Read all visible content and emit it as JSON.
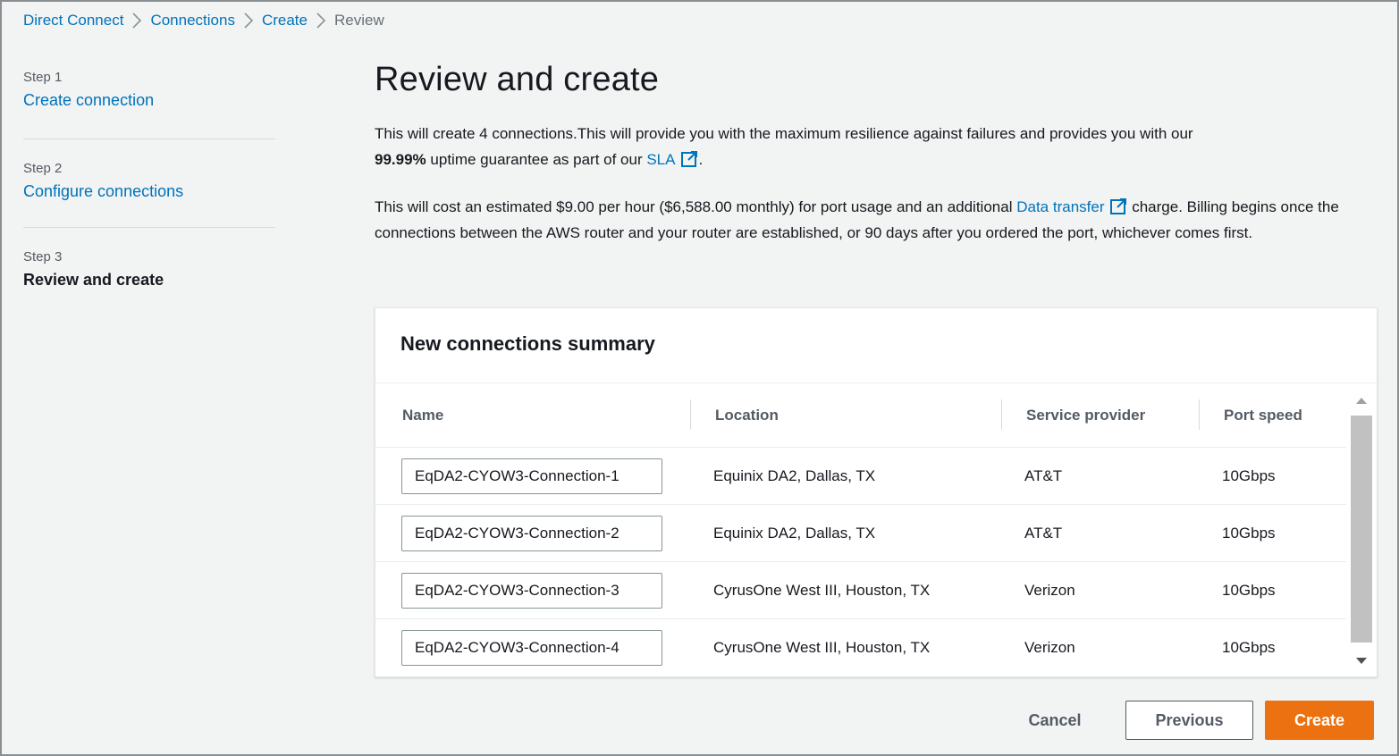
{
  "breadcrumb": [
    {
      "label": "Direct Connect"
    },
    {
      "label": "Connections"
    },
    {
      "label": "Create"
    },
    {
      "label": "Review"
    }
  ],
  "steps": [
    {
      "num": "Step 1",
      "label": "Create connection"
    },
    {
      "num": "Step 2",
      "label": "Configure connections"
    },
    {
      "num": "Step 3",
      "label": "Review and create"
    }
  ],
  "page": {
    "title": "Review and create",
    "intro_1": "This will create 4 connections.This will provide you with the maximum resilience against failures and provides you with our",
    "uptime": "99.99%",
    "intro_2": "uptime guarantee as part of our",
    "sla_link": "SLA",
    "cost_1": "This will cost an estimated $9.00 per hour ($6,588.00 monthly) for port usage and an additional",
    "data_transfer_link": "Data transfer",
    "cost_2": "charge.",
    "billing": "Billing begins once the connections between the AWS router and your router are established, or 90 days after you ordered the port, whichever comes first."
  },
  "summary": {
    "title": "New connections summary",
    "columns": [
      "Name",
      "Location",
      "Service provider",
      "Port speed"
    ],
    "rows": [
      {
        "name": "EqDA2-CYOW3-Connection-1",
        "location": "Equinix DA2, Dallas, TX",
        "provider": "AT&T",
        "speed": "10Gbps"
      },
      {
        "name": "EqDA2-CYOW3-Connection-2",
        "location": "Equinix DA2, Dallas, TX",
        "provider": "AT&T",
        "speed": "10Gbps"
      },
      {
        "name": "EqDA2-CYOW3-Connection-3",
        "location": "CyrusOne West III, Houston, TX",
        "provider": "Verizon",
        "speed": "10Gbps"
      },
      {
        "name": "EqDA2-CYOW3-Connection-4",
        "location": "CyrusOne West III, Houston, TX",
        "provider": "Verizon",
        "speed": "10Gbps"
      }
    ]
  },
  "actions": {
    "cancel": "Cancel",
    "previous": "Previous",
    "create": "Create"
  },
  "colors": {
    "link": "#0073bb",
    "primary": "#ec7211",
    "background": "#f2f3f3"
  },
  "icons": {
    "breadcrumb_separator": "chevron-right-icon",
    "external_link": "external-link-icon",
    "scroll_up": "triangle-up-icon",
    "scroll_down": "triangle-down-icon"
  }
}
